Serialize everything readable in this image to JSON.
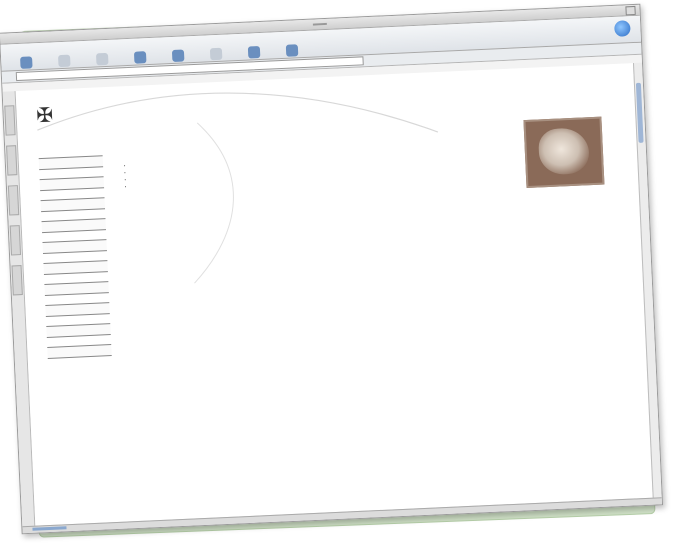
{
  "window": {
    "title": ""
  },
  "toolbar": {
    "buttons": [
      {
        "label": "",
        "icon": "back-icon"
      },
      {
        "label": "",
        "icon": "forward-icon"
      },
      {
        "label": "",
        "icon": "stop-icon"
      },
      {
        "label": "",
        "icon": "refresh-icon"
      },
      {
        "label": "",
        "icon": "home-icon"
      },
      {
        "label": "",
        "icon": "autofill-icon"
      },
      {
        "label": "",
        "icon": "print-icon"
      },
      {
        "label": "",
        "icon": "mail-icon"
      }
    ]
  },
  "address": {
    "label": "",
    "value": "",
    "go_label": ""
  },
  "favorites": [],
  "site": {
    "title": "",
    "contact": [],
    "contact_email": ""
  },
  "nav": {
    "items": []
  },
  "main": {
    "welcome": "",
    "links": [],
    "photo_caption": ""
  },
  "colors": {
    "backing": "#cfe0c6",
    "link": "#b03030",
    "toolbar_icon": "#6a8fbf"
  }
}
